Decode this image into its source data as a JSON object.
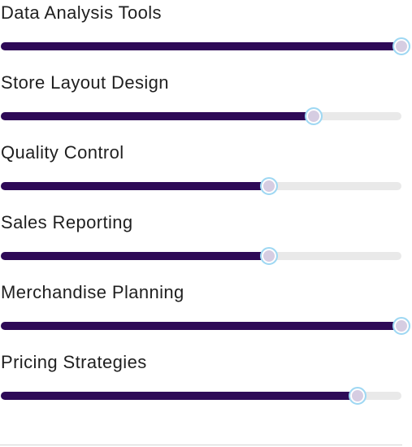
{
  "accent_color": "#2e0a57",
  "track_color": "#e9e9e9",
  "thumb_ring_color": "#9ed8f3",
  "skills": [
    {
      "label": "Data Analysis Tools",
      "value_percent": 100
    },
    {
      "label": "Store Layout Design",
      "value_percent": 78
    },
    {
      "label": "Quality Control",
      "value_percent": 67
    },
    {
      "label": "Sales Reporting",
      "value_percent": 67
    },
    {
      "label": "Merchandise Planning",
      "value_percent": 100
    },
    {
      "label": "Pricing Strategies",
      "value_percent": 89
    }
  ]
}
